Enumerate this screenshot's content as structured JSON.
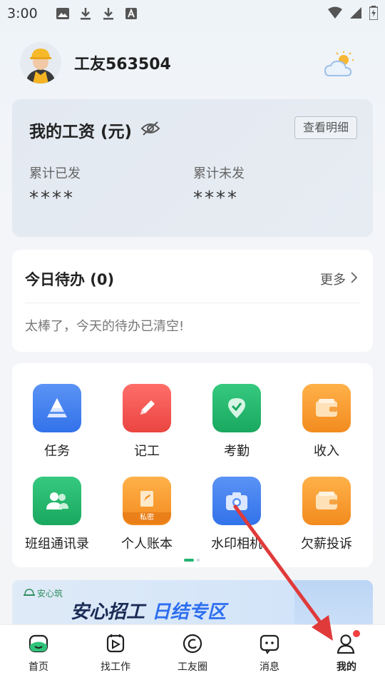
{
  "status_bar": {
    "time": "3:00",
    "icons_left": [
      "image-icon",
      "download-icon",
      "download-icon",
      "font-icon"
    ],
    "icons_right": [
      "wifi-icon",
      "signal-icon",
      "battery-icon"
    ]
  },
  "header": {
    "username": "工友563504",
    "weather_icon": "cloud-sun-icon"
  },
  "salary": {
    "title": "我的工资 (元)",
    "detail_button": "查看明细",
    "paid_label": "累计已发",
    "paid_value": "****",
    "unpaid_label": "累计未发",
    "unpaid_value": "****"
  },
  "todo": {
    "title": "今日待办 (0)",
    "more": "更多",
    "empty_text": "太棒了，今天的待办已清空!"
  },
  "grid": {
    "items": [
      {
        "label": "任务",
        "icon": "task-icon",
        "color": "#3f7df0"
      },
      {
        "label": "记工",
        "icon": "pencil-icon",
        "color": "#f0504b"
      },
      {
        "label": "考勤",
        "icon": "location-check-icon",
        "color": "#20b36a"
      },
      {
        "label": "收入",
        "icon": "wallet-icon",
        "color": "#f59a2c"
      },
      {
        "label": "班组通讯录",
        "icon": "contacts-icon",
        "color": "#20b36a"
      },
      {
        "label": "个人账本",
        "icon": "ledger-icon",
        "color": "#f59a2c",
        "badge": "私密"
      },
      {
        "label": "水印相机",
        "icon": "camera-icon",
        "color": "#3f7df0"
      },
      {
        "label": "欠薪投诉",
        "icon": "wallet-icon",
        "color": "#f59a2c"
      }
    ],
    "page_indicator": {
      "current": 1,
      "total": 2
    }
  },
  "banner": {
    "logo_text": "安心筑",
    "title_part1": "安心招工",
    "title_part2": "日结专区"
  },
  "tab_bar": {
    "tabs": [
      {
        "label": "首页",
        "icon": "home-icon",
        "active": false
      },
      {
        "label": "找工作",
        "icon": "find-job-icon",
        "active": false
      },
      {
        "label": "工友圈",
        "icon": "circle-icon",
        "active": false
      },
      {
        "label": "消息",
        "icon": "message-icon",
        "active": false
      },
      {
        "label": "我的",
        "icon": "profile-icon",
        "active": true,
        "badge": true
      }
    ]
  },
  "colors": {
    "accent_green": "#22b573",
    "arrow_red": "#e03a3a"
  }
}
